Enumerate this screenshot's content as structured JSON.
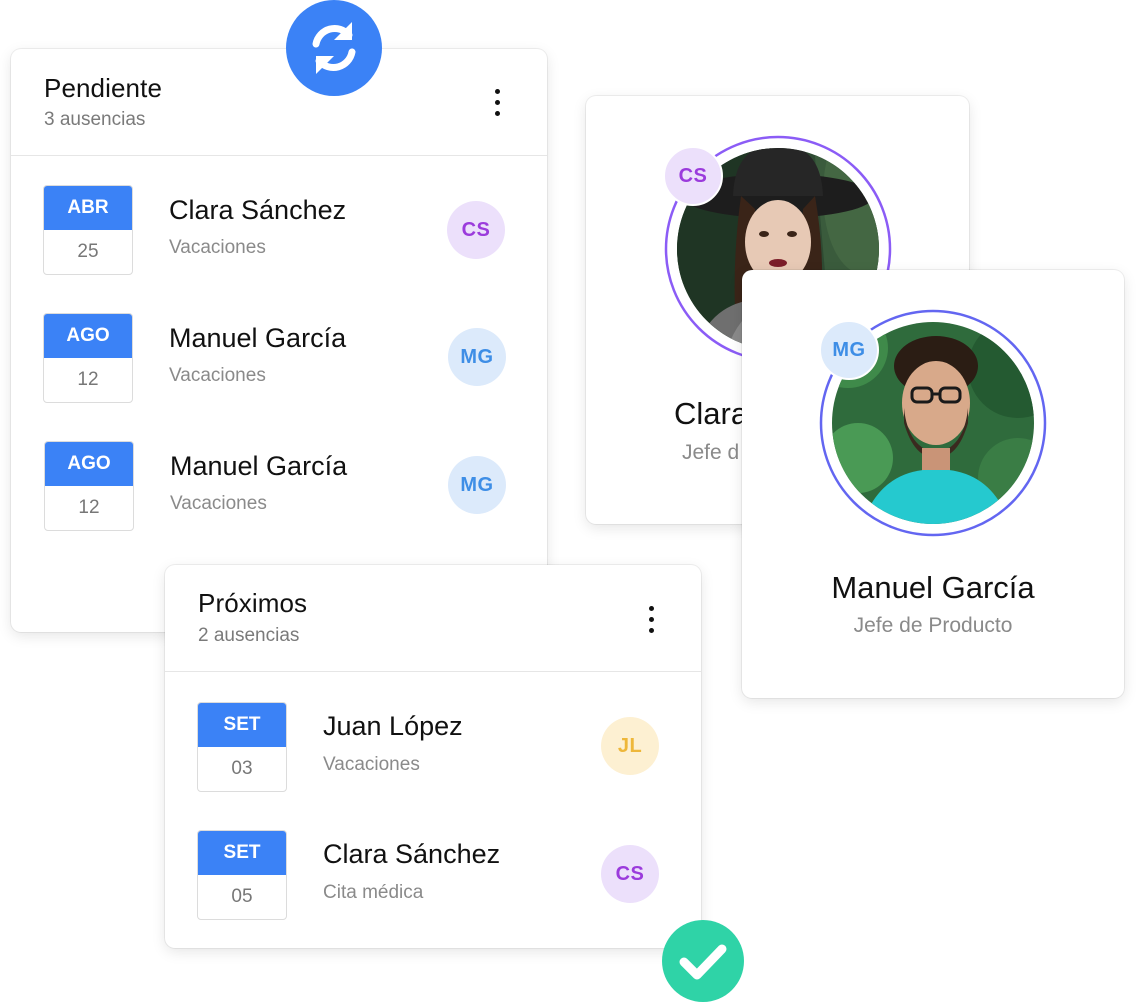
{
  "pending": {
    "title": "Pendiente",
    "subtitle": "3 ausencias",
    "rows": [
      {
        "month": "ABR",
        "day": "25",
        "name": "Clara Sánchez",
        "type": "Vacaciones",
        "initials": "CS"
      },
      {
        "month": "AGO",
        "day": "12",
        "name": "Manuel García",
        "type": "Vacaciones",
        "initials": "MG"
      },
      {
        "month": "AGO",
        "day": "12",
        "name": "Manuel García",
        "type": "Vacaciones",
        "initials": "MG"
      }
    ]
  },
  "upcoming": {
    "title": "Próximos",
    "subtitle": "2 ausencias",
    "rows": [
      {
        "month": "SET",
        "day": "03",
        "name": "Juan López",
        "type": "Vacaciones",
        "initials": "JL"
      },
      {
        "month": "SET",
        "day": "05",
        "name": "Clara Sánchez",
        "type": "Cita médica",
        "initials": "CS"
      }
    ]
  },
  "profile_back": {
    "initials": "CS",
    "name_partial": "Clara",
    "role_partial": "Jefe d"
  },
  "profile_front": {
    "initials": "MG",
    "name": "Manuel García",
    "role": "Jefe de Producto"
  },
  "icons": {
    "sync": "sync-icon",
    "check": "check-icon",
    "menu": "more-vertical-icon"
  },
  "colors": {
    "accent_blue": "#3b82f6",
    "success_green": "#2fd3a7",
    "ring_purple": "#8b5cf6",
    "ring_indigo": "#6366f1",
    "badge_cs_bg": "#ece0fb",
    "badge_mg_bg": "#dceafb",
    "badge_jl_bg": "#fdf0d2"
  }
}
